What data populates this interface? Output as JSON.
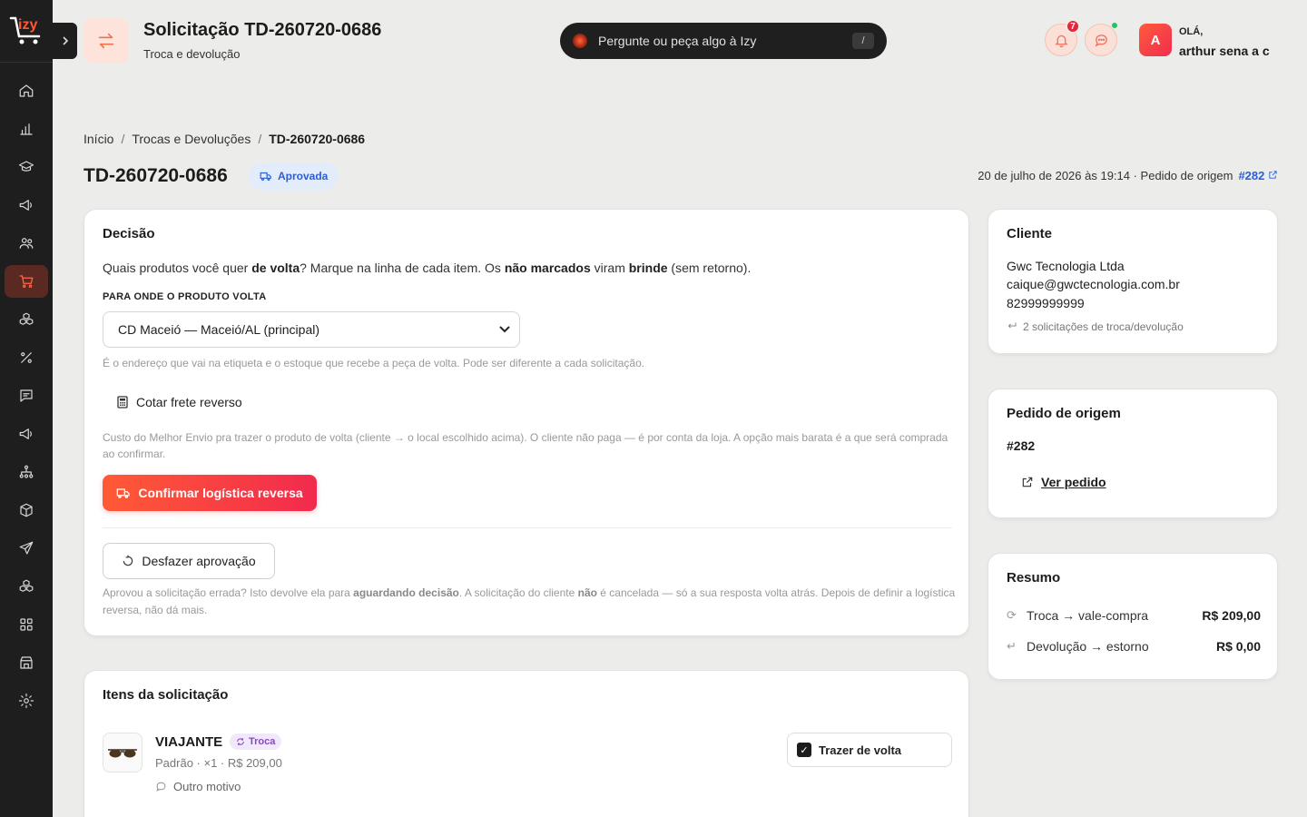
{
  "logo_text": "izy",
  "header": {
    "title": "Solicitação TD-260720-0686",
    "subtitle": "Troca e devolução",
    "search_placeholder": "Pergunte ou peça algo à Izy",
    "search_shortcut": "/",
    "notifications_count": "7",
    "greeting": "OLÁ,",
    "username": "arthur sena a c",
    "avatar_initial": "A"
  },
  "breadcrumb": {
    "home": "Início",
    "section": "Trocas e Devoluções",
    "current": "TD-260720-0686",
    "separator": "/"
  },
  "request": {
    "code": "TD-260720-0686",
    "status": "Aprovada",
    "date": "20 de julho de 2026 às 19:14 · Pedido de origem",
    "origin_order": "#282"
  },
  "decision": {
    "title": "Decisão",
    "question_parts": [
      "Quais produtos você quer ",
      "de volta",
      "? Marque na linha de cada item. Os ",
      "não marcados",
      " viram ",
      "brinde",
      " (sem retorno)."
    ],
    "destination_label": "PARA ONDE O PRODUTO VOLTA",
    "destination_value": "CD Maceió — Maceió/AL (principal)",
    "destination_hint": "É o endereço que vai na etiqueta e o estoque que recebe a peça de volta. Pode ser diferente a cada solicitação.",
    "quote_label": "Cotar frete reverso",
    "quote_hint": "Custo do Melhor Envio pra trazer o produto de volta (cliente → o local escolhido acima). O cliente não paga — é por conta da loja. A opção mais barata é a que será comprada ao confirmar.",
    "confirm_label": "Confirmar logística reversa",
    "undo_label": "Desfazer aprovação",
    "undo_hint_parts": [
      "Aprovou a solicitação errada? Isto devolve ela para ",
      "aguardando decisão",
      ". A solicitação do cliente ",
      "não",
      " é cancelada — só a sua resposta volta atrás. Depois de definir a logística reversa, não dá mais."
    ]
  },
  "items": {
    "title": "Itens da solicitação",
    "list": [
      {
        "name": "VIAJANTE",
        "tag": "Troca",
        "meta": "Padrão · ×1 · R$ 209,00",
        "reason": "Outro motivo",
        "bring_back_label": "Trazer de volta",
        "bring_back_checked": true
      }
    ]
  },
  "client": {
    "title": "Cliente",
    "company": "Gwc Tecnologia Ltda",
    "email": "caique@gwctecnologia.com.br",
    "phone": "82999999999",
    "requests_count": "2 solicitações de troca/devolução"
  },
  "order": {
    "title": "Pedido de origem",
    "number": "#282",
    "view_label": "Ver pedido"
  },
  "summary": {
    "title": "Resumo",
    "rows": [
      {
        "label": "Troca → vale-compra",
        "value": "R$ 209,00"
      },
      {
        "label": "Devolução → estorno",
        "value": "R$ 0,00"
      }
    ]
  },
  "colors": {
    "accent": "#ff5a35",
    "accent_end": "#f22a4e",
    "status_blue": "#2b5fd6",
    "sidebar": "#1e1e1e"
  },
  "nav_icons": [
    "home-icon",
    "chart-icon",
    "graduation-icon",
    "megaphone-icon",
    "users-icon",
    "cart-icon",
    "boxes-icon",
    "percent-icon",
    "message-icon",
    "megaphone-2-icon",
    "sitemap-icon",
    "package-icon",
    "send-icon",
    "boxes-2-icon",
    "grid-icon",
    "store-icon",
    "settings-icon"
  ]
}
